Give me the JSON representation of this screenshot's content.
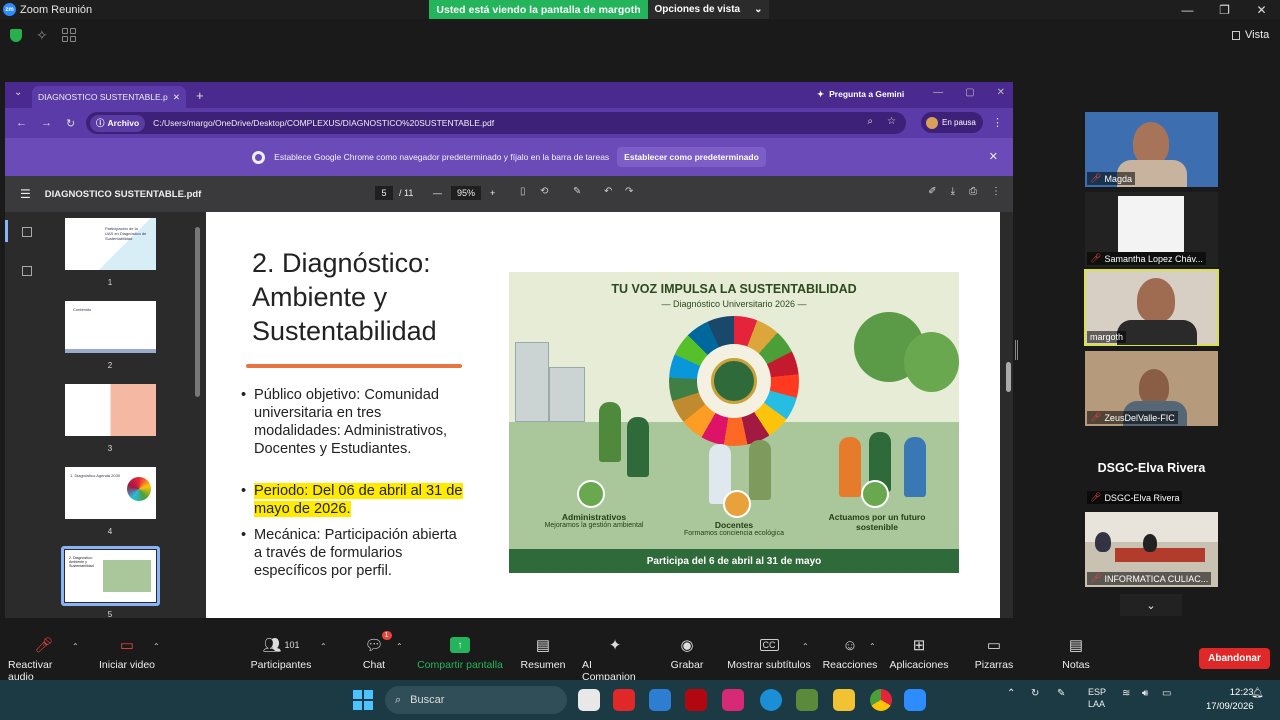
{
  "app": {
    "title": "Zoom Reunión"
  },
  "share_banner": {
    "message": "Usted está viendo la pantalla de margoth",
    "options": "Opciones de vista"
  },
  "zoom_view": {
    "label": "Vista"
  },
  "browser": {
    "tab_title": "DIAGNOSTICO SUSTENTABLE.p",
    "gemini": "Pregunta a Gemini",
    "address_chip": "Archivo",
    "url": "C:/Users/margo/OneDrive/Desktop/COMPLEXUS/DIAGNOSTICO%20SUSTENTABLE.pdf",
    "profile_status": "En pausa",
    "infobar_text": "Establece Google Chrome como navegador predeterminado y fíjalo en la barra de tareas",
    "infobar_button": "Establecer como predeterminado"
  },
  "pdf": {
    "filename": "DIAGNOSTICO SUSTENTABLE.pdf",
    "current_page": "5",
    "total_pages": "/ 11",
    "zoom": "95%",
    "thumbnails": [
      {
        "num": "1",
        "text": "Participación de la UAS en Diagnóstico de Sustentabilidad"
      },
      {
        "num": "2",
        "text": "Contenido"
      },
      {
        "num": "3",
        "text": ""
      },
      {
        "num": "4",
        "text": "1. Diagnóstico Agenda 2030"
      },
      {
        "num": "5",
        "text": "2. Diagnóstico: Ambiente y Sustentabilidad"
      }
    ]
  },
  "slide": {
    "title": "2. Diagnóstico: Ambiente y Sustentabilidad",
    "bullets": [
      "Público objetivo: Comunidad universitaria en tres modalidades: Administrativos, Docentes y Estudiantes.",
      "Periodo: Del 06 de abril al 31 de mayo de 2026.",
      "Mecánica: Participación abierta a través de formularios específicos por perfil."
    ],
    "poster": {
      "title": "TU VOZ IMPULSA LA SUSTENTABILIDAD",
      "subtitle": "— Diagnóstico Universitario 2026 —",
      "groups": [
        {
          "name": "Administrativos",
          "desc": "Mejoramos la gestión ambiental"
        },
        {
          "name": "Docentes",
          "desc": "Formamos conciencia ecológica"
        },
        {
          "name": "Actuamos por un futuro sostenible",
          "desc": ""
        }
      ],
      "footer": "Participa del 6 de abril al 31 de mayo"
    }
  },
  "participants": [
    {
      "name": "Magda",
      "muted": true
    },
    {
      "name": "Samantha Lopez Cháv...",
      "muted": true
    },
    {
      "name": "margoth",
      "muted": false,
      "active": true
    },
    {
      "name": "ZeusDelValle-FIC",
      "muted": true
    },
    {
      "name": "DSGC-Elva Rivera",
      "muted": true,
      "display": "DSGC-Elva Rivera"
    },
    {
      "name": "INFORMATICA CULIAC...",
      "muted": true
    }
  ],
  "toolbar": {
    "mute": "Reactivar audio",
    "video": "Iniciar video",
    "participants": "Participantes",
    "participants_count": "101",
    "chat": "Chat",
    "chat_badge": "1",
    "share": "Compartir pantalla",
    "summary": "Resumen",
    "companion": "AI Companion",
    "record": "Grabar",
    "captions": "Mostrar subtítulos",
    "captions_icon": "CC",
    "reactions": "Reacciones",
    "apps": "Aplicaciones",
    "whiteboards": "Pizarras",
    "notes": "Notas",
    "leave": "Abandonar"
  },
  "taskbar": {
    "search": "Buscar",
    "lang": "ESP",
    "lang2": "LAA",
    "time": "12:23",
    "date": "17/09/2026"
  },
  "colors": {
    "zoom_green": "#23b45c",
    "chrome_purple": "#5b3ba8",
    "highlight": "#ffeb00",
    "leave_red": "#e02828"
  }
}
